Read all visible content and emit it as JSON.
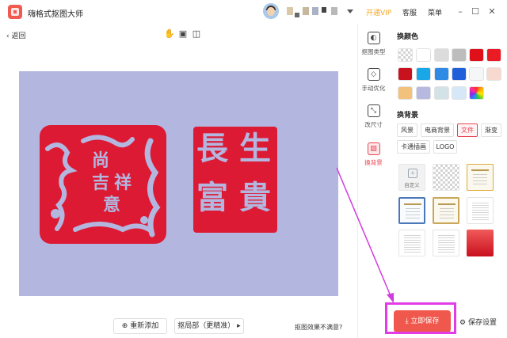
{
  "app": {
    "title": "嗨格式抠图大师"
  },
  "header": {
    "vip": "开通VIP",
    "service": "客服",
    "menu": "菜单"
  },
  "toolbar": {
    "back": "返回"
  },
  "seals": {
    "left": [
      "尚",
      "吉",
      "祥",
      "意"
    ],
    "right": [
      "長",
      "生",
      "富",
      "貴"
    ]
  },
  "bottom": {
    "add": "重新添加",
    "refine": "抠局部（更精准）",
    "feedback": "抠图效果不满意?"
  },
  "sidetabs": [
    {
      "label": "抠图类型",
      "icon": "cutout-type-icon"
    },
    {
      "label": "手动优化",
      "icon": "eraser-icon"
    },
    {
      "label": "改尺寸",
      "icon": "resize-icon"
    },
    {
      "label": "换背景",
      "icon": "background-icon"
    }
  ],
  "panel": {
    "color_title": "换颜色",
    "colors": [
      "transparent",
      "#ffffff",
      "#dcdcdc",
      "#bdbdbd",
      "#e0101a",
      "#ea1b24",
      "#c8131e",
      "#1aa7e8",
      "#2d8be6",
      "#1f5fd9",
      "#f4f6f8",
      "#f7d9d0",
      "#f2c27c",
      "#b8b9e1",
      "#d3e2e6",
      "#d6e7f7",
      "rainbow"
    ],
    "bg_title": "换背景",
    "categories": [
      "风景",
      "电商背景",
      "文件",
      "渐变",
      "卡通插画",
      "LOGO"
    ],
    "active_category": "文件",
    "custom_label": "自定义",
    "save_button": "立即保存",
    "save_settings": "保存设置"
  },
  "colors": {
    "accent": "#f0584d",
    "highlight": "#e23ce6",
    "seal": "#dd1a34",
    "canvas_bg": "#b3b6df"
  }
}
